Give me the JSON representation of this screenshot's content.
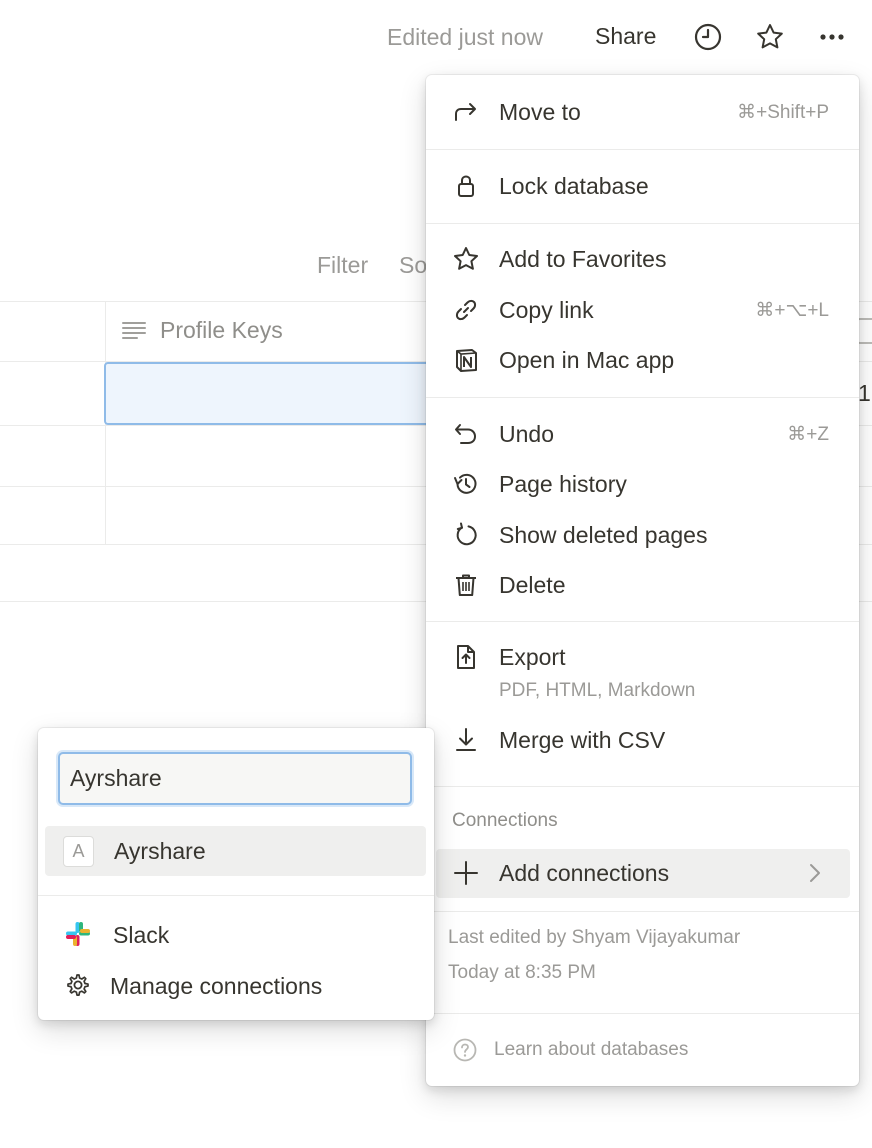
{
  "topbar": {
    "edited_text": "Edited just now",
    "share_label": "Share",
    "icons": [
      "clock-icon",
      "star-icon",
      "more-icon"
    ]
  },
  "database": {
    "filter_label": "Filter",
    "sort_label_partial": "So",
    "column_header": "Profile Keys",
    "edge_digit": "1"
  },
  "menu": {
    "move_to": {
      "label": "Move to",
      "shortcut": "⌘+Shift+P",
      "icon": "arrow-turn-right-icon"
    },
    "lock": {
      "label": "Lock database",
      "icon": "lock-icon"
    },
    "favorites": {
      "label": "Add to Favorites",
      "icon": "star-icon"
    },
    "copy_link": {
      "label": "Copy link",
      "shortcut": "⌘+⌥+L",
      "icon": "link-icon"
    },
    "open_mac": {
      "label": "Open in Mac app",
      "icon": "notion-logo-icon"
    },
    "undo": {
      "label": "Undo",
      "shortcut": "⌘+Z",
      "icon": "undo-icon"
    },
    "page_history": {
      "label": "Page history",
      "icon": "history-icon"
    },
    "show_deleted": {
      "label": "Show deleted pages",
      "icon": "restore-icon"
    },
    "delete": {
      "label": "Delete",
      "icon": "trash-icon"
    },
    "export": {
      "label": "Export",
      "sub": "PDF, HTML, Markdown",
      "icon": "export-file-icon"
    },
    "merge": {
      "label": "Merge with CSV",
      "icon": "download-icon"
    },
    "connections_heading": "Connections",
    "add_connections": {
      "label": "Add connections",
      "icon": "plus-icon"
    },
    "last_edited_by": "Last edited by Shyam Vijayakumar",
    "last_edited_time": "Today at 8:35 PM",
    "learn": "Learn about databases"
  },
  "connections_popover": {
    "search_value": "Ayrshare",
    "result_label": "Ayrshare",
    "result_avatar": "A",
    "slack_label": "Slack",
    "manage_label": "Manage connections"
  },
  "colors": {
    "accent_blue": "#8fbbe8",
    "selected_cell": "#eef5fd",
    "hover_gray": "#efefee",
    "text": "#37352f",
    "muted": "#9b9a97"
  }
}
